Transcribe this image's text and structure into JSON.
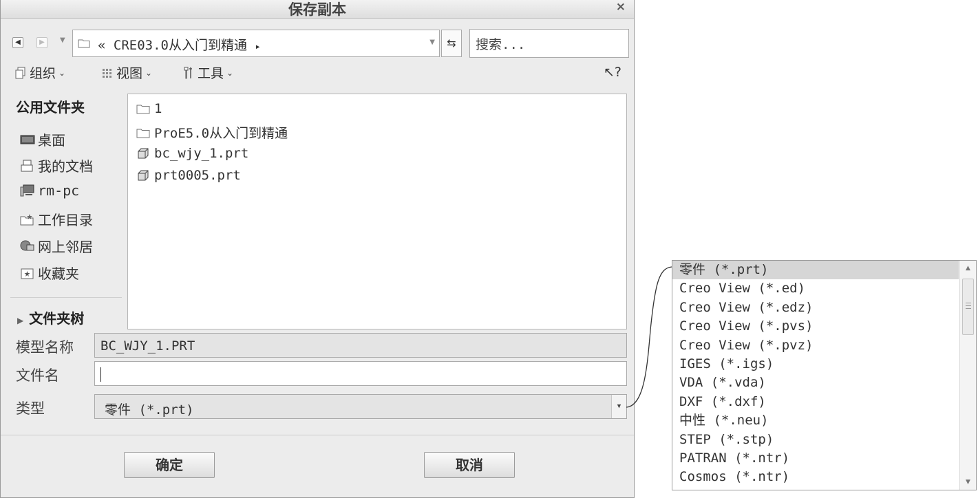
{
  "dialog": {
    "title": "保存副本",
    "close_glyph": "×"
  },
  "navigation": {
    "back_icon": "arrow-left-icon",
    "forward_icon": "arrow-right-icon",
    "address_prefix": "«",
    "address_path": "CRE03.0从入门到精通",
    "address_arrow": "▸",
    "refresh_icon": "refresh-icon",
    "search_placeholder": "搜索..."
  },
  "toolbar": {
    "organize": "组织",
    "view": "视图",
    "tools": "工具",
    "help_icon": "help-pointer-icon"
  },
  "sidebar": {
    "heading": "公用文件夹",
    "items": [
      {
        "label": "桌面",
        "icon": "desktop-icon"
      },
      {
        "label": "我的文档",
        "icon": "documents-icon"
      },
      {
        "label": "rm-pc",
        "icon": "computer-icon"
      },
      {
        "label": "工作目录",
        "icon": "working-directory-icon"
      },
      {
        "label": "网上邻居",
        "icon": "network-icon"
      },
      {
        "label": "收藏夹",
        "icon": "favorites-icon"
      }
    ],
    "folder_tree": "文件夹树"
  },
  "files": [
    {
      "name": "1",
      "kind": "folder"
    },
    {
      "name": "ProE5.0从入门到精通",
      "kind": "folder"
    },
    {
      "name": "bc_wjy_1.prt",
      "kind": "part"
    },
    {
      "name": "prt0005.prt",
      "kind": "part"
    }
  ],
  "form": {
    "model_name_label": "模型名称",
    "model_name_value": "BC_WJY_1.PRT",
    "file_name_label": "文件名",
    "file_name_value": "",
    "type_label": "类型",
    "type_value": "零件 (*.prt)"
  },
  "buttons": {
    "ok": "确定",
    "cancel": "取消"
  },
  "type_options": [
    "零件 (*.prt)",
    "Creo View (*.ed)",
    "Creo View (*.edz)",
    "Creo View (*.pvs)",
    "Creo View (*.pvz)",
    "IGES (*.igs)",
    "VDA (*.vda)",
    "DXF (*.dxf)",
    "中性 (*.neu)",
    "STEP (*.stp)",
    "PATRAN (*.ntr)",
    "Cosmos (*.ntr)"
  ],
  "type_options_selected_index": 0,
  "colors": {
    "dialog_bg": "#ececec",
    "selected_option_bg": "#d6d6d6"
  }
}
